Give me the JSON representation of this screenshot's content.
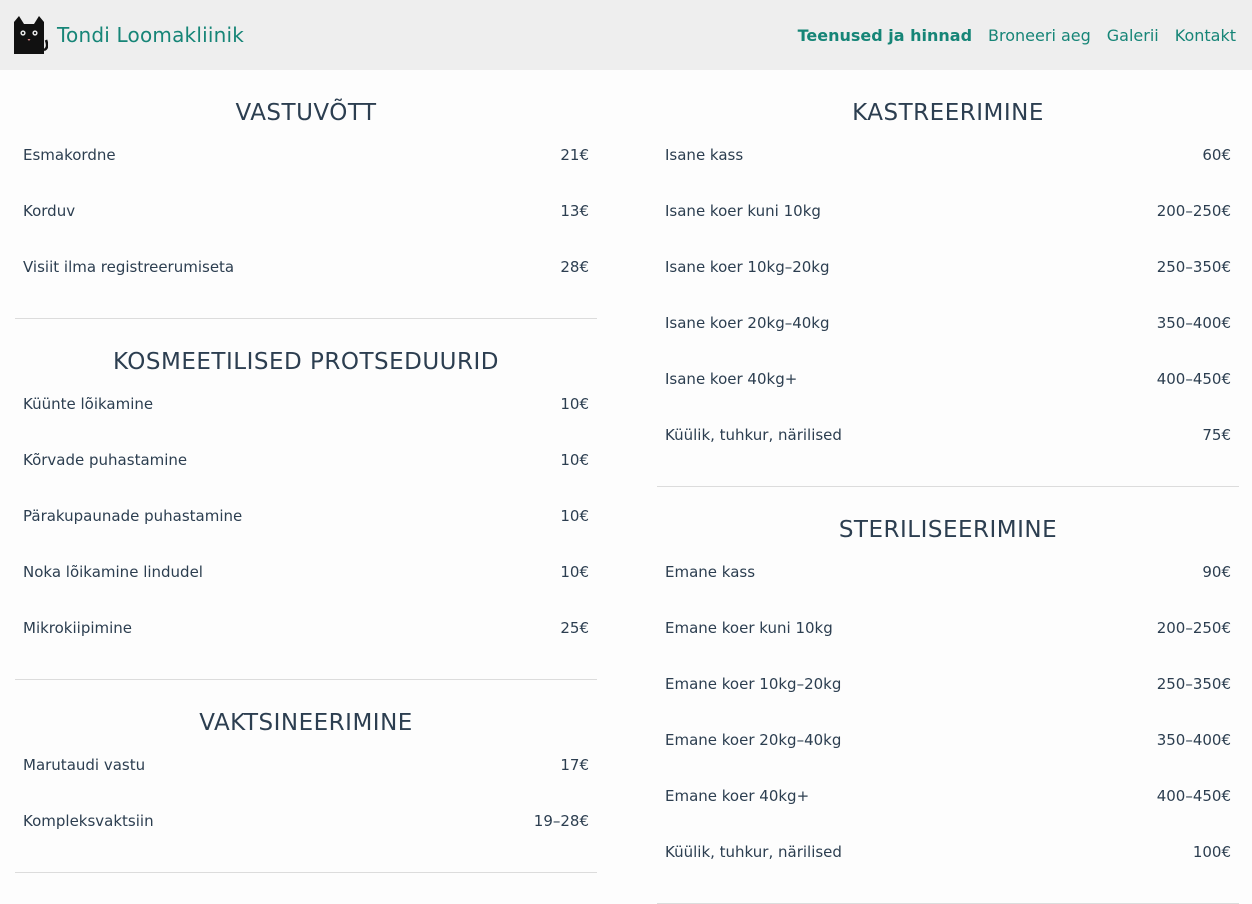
{
  "brand": {
    "name": "Tondi Loomakliinik",
    "logo_icon": "black-cat-icon"
  },
  "nav": [
    {
      "label": "Teenused ja hinnad",
      "active": true
    },
    {
      "label": "Broneeri aeg",
      "active": false
    },
    {
      "label": "Galerii",
      "active": false
    },
    {
      "label": "Kontakt",
      "active": false
    }
  ],
  "colors": {
    "accent": "#168577",
    "text": "#2c3e50",
    "navbar_bg": "#eeeeee"
  },
  "left": [
    {
      "title": "VASTUVÕTT",
      "items": [
        {
          "name": "Esmakordne",
          "price": "21€"
        },
        {
          "name": "Korduv",
          "price": "13€"
        },
        {
          "name": "Visiit ilma registreerumiseta",
          "price": "28€"
        }
      ]
    },
    {
      "title": "KOSMEETILISED PROTSEDUURID",
      "items": [
        {
          "name": "Küünte lõikamine",
          "price": "10€"
        },
        {
          "name": "Kõrvade puhastamine",
          "price": "10€"
        },
        {
          "name": "Pärakupaunade puhastamine",
          "price": "10€"
        },
        {
          "name": "Noka lõikamine lindudel",
          "price": "10€"
        },
        {
          "name": "Mikrokiipimine",
          "price": "25€"
        }
      ]
    },
    {
      "title": "VAKTSINEERIMINE",
      "items": [
        {
          "name": "Marutaudi vastu",
          "price": "17€"
        },
        {
          "name": "Kompleksvaktsiin",
          "price": "19–28€"
        }
      ]
    }
  ],
  "right": [
    {
      "title": "KASTREERIMINE",
      "items": [
        {
          "name": "Isane kass",
          "price": "60€"
        },
        {
          "name": "Isane koer kuni 10kg",
          "price": "200–250€"
        },
        {
          "name": "Isane koer 10kg–20kg",
          "price": "250–350€"
        },
        {
          "name": "Isane koer 20kg–40kg",
          "price": "350–400€"
        },
        {
          "name": "Isane koer 40kg+",
          "price": "400–450€"
        },
        {
          "name": "Küülik, tuhkur, närilised",
          "price": "75€"
        }
      ]
    },
    {
      "title": "STERILISEERIMINE",
      "items": [
        {
          "name": "Emane kass",
          "price": "90€"
        },
        {
          "name": "Emane koer kuni 10kg",
          "price": "200–250€"
        },
        {
          "name": "Emane koer 10kg–20kg",
          "price": "250–350€"
        },
        {
          "name": "Emane koer 20kg–40kg",
          "price": "350–400€"
        },
        {
          "name": "Emane koer 40kg+",
          "price": "400–450€"
        },
        {
          "name": "Küülik, tuhkur, närilised",
          "price": "100€"
        }
      ]
    }
  ]
}
